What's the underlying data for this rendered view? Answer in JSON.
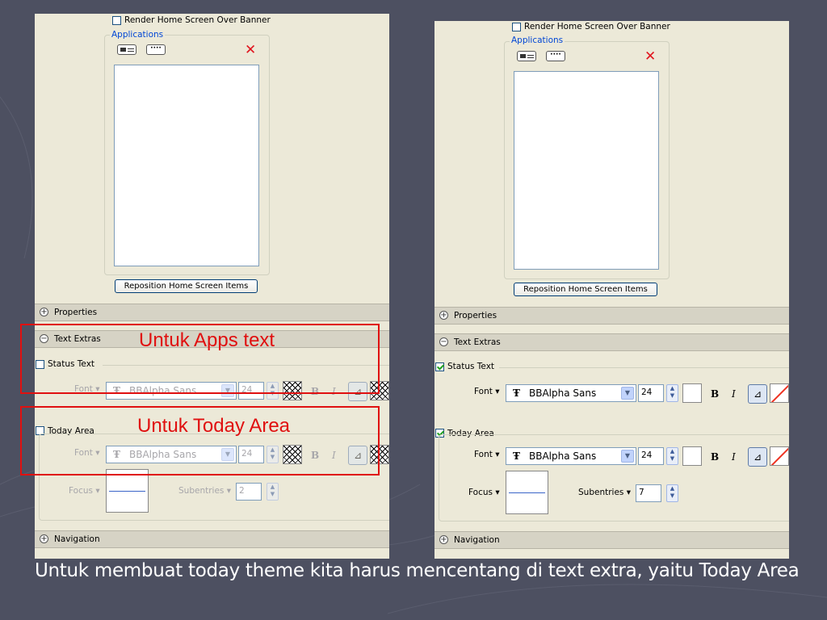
{
  "render_home_label": "Render Home Screen Over Banner",
  "applications_legend": "Applications",
  "reposition_button": "Reposition Home Screen Items",
  "sections": {
    "properties": "Properties",
    "text_extras": "Text Extras",
    "navigation": "Navigation"
  },
  "status_text_label": "Status Text",
  "today_area_label": "Today Area",
  "font_label": "Font",
  "font_name": "BBAlpha Sans",
  "font_size": "24",
  "focus_label": "Focus",
  "subentries_label": "Subentries",
  "left": {
    "subentries_value": "2",
    "status_checked": false,
    "today_checked": false
  },
  "right": {
    "subentries_value": "7",
    "status_checked": true,
    "today_checked": true
  },
  "annotations": {
    "apps": "Untuk Apps text",
    "today": "Untuk Today Area"
  },
  "caption": "Untuk membuat today theme kita harus mencentang di text extra, yaitu Today Area",
  "colors": {
    "annotation": "#e01010",
    "background": "#4d5061",
    "panel": "#ece9d8"
  },
  "icons": [
    "card-icon",
    "dots-icon",
    "delete-x-icon",
    "expand-plus-icon",
    "collapse-minus-icon",
    "text-type-icon",
    "align-icon"
  ]
}
